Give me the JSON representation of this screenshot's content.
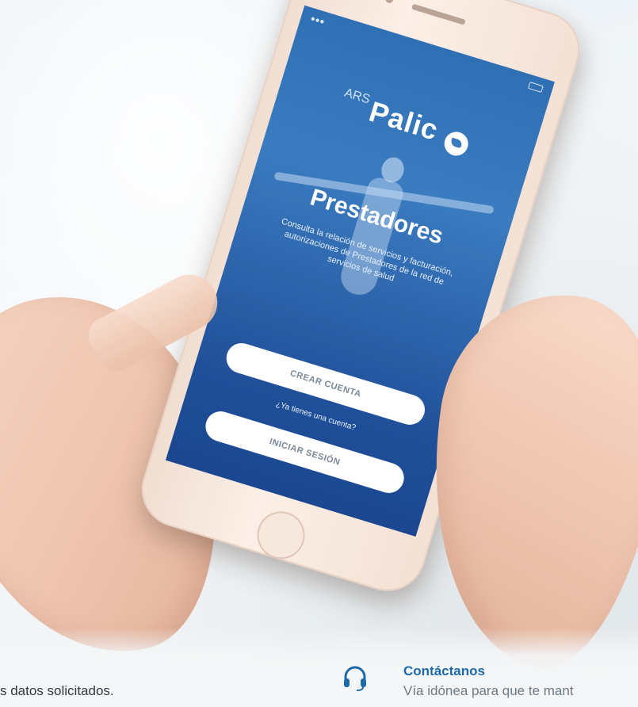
{
  "app": {
    "brand_prefix": "ARS",
    "brand_name": "Palic",
    "title": "Prestadores",
    "description": "Consulta la relación de servicios y facturación, autorizaciones de Prestadores de la red de servicios de salud",
    "create_account_label": "CREAR CUENTA",
    "have_account_text": "¿Ya tienes una cuenta?",
    "login_label": "INICIAR SESIÓN"
  },
  "page": {
    "left_caption": "s datos solicitados.",
    "contact_title": "Contáctanos",
    "contact_text": "Vía idónea para que te mant"
  },
  "colors": {
    "screen_blue": "#2f6fb4",
    "contact_accent": "#1e6aa8"
  },
  "icons": {
    "contact": "headset-icon",
    "brand": "bird-logo-icon"
  }
}
